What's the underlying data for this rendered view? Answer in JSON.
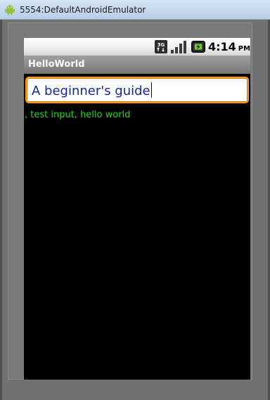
{
  "window": {
    "title": "5554:DefaultAndroidEmulator",
    "icon": "android-icon"
  },
  "status_bar": {
    "network_badge": "3G",
    "signal_icon": "signal-bars-icon",
    "battery_icon": "battery-charging-icon",
    "time": "4:14",
    "ampm": "PM"
  },
  "app": {
    "title": "HelloWorld"
  },
  "edit_field": {
    "value": "A beginner's guide",
    "focused": true,
    "border_color": "#ff9a1a",
    "text_color": "#142896"
  },
  "output": {
    "text": ", test input, hello world",
    "color": "#25d425"
  }
}
